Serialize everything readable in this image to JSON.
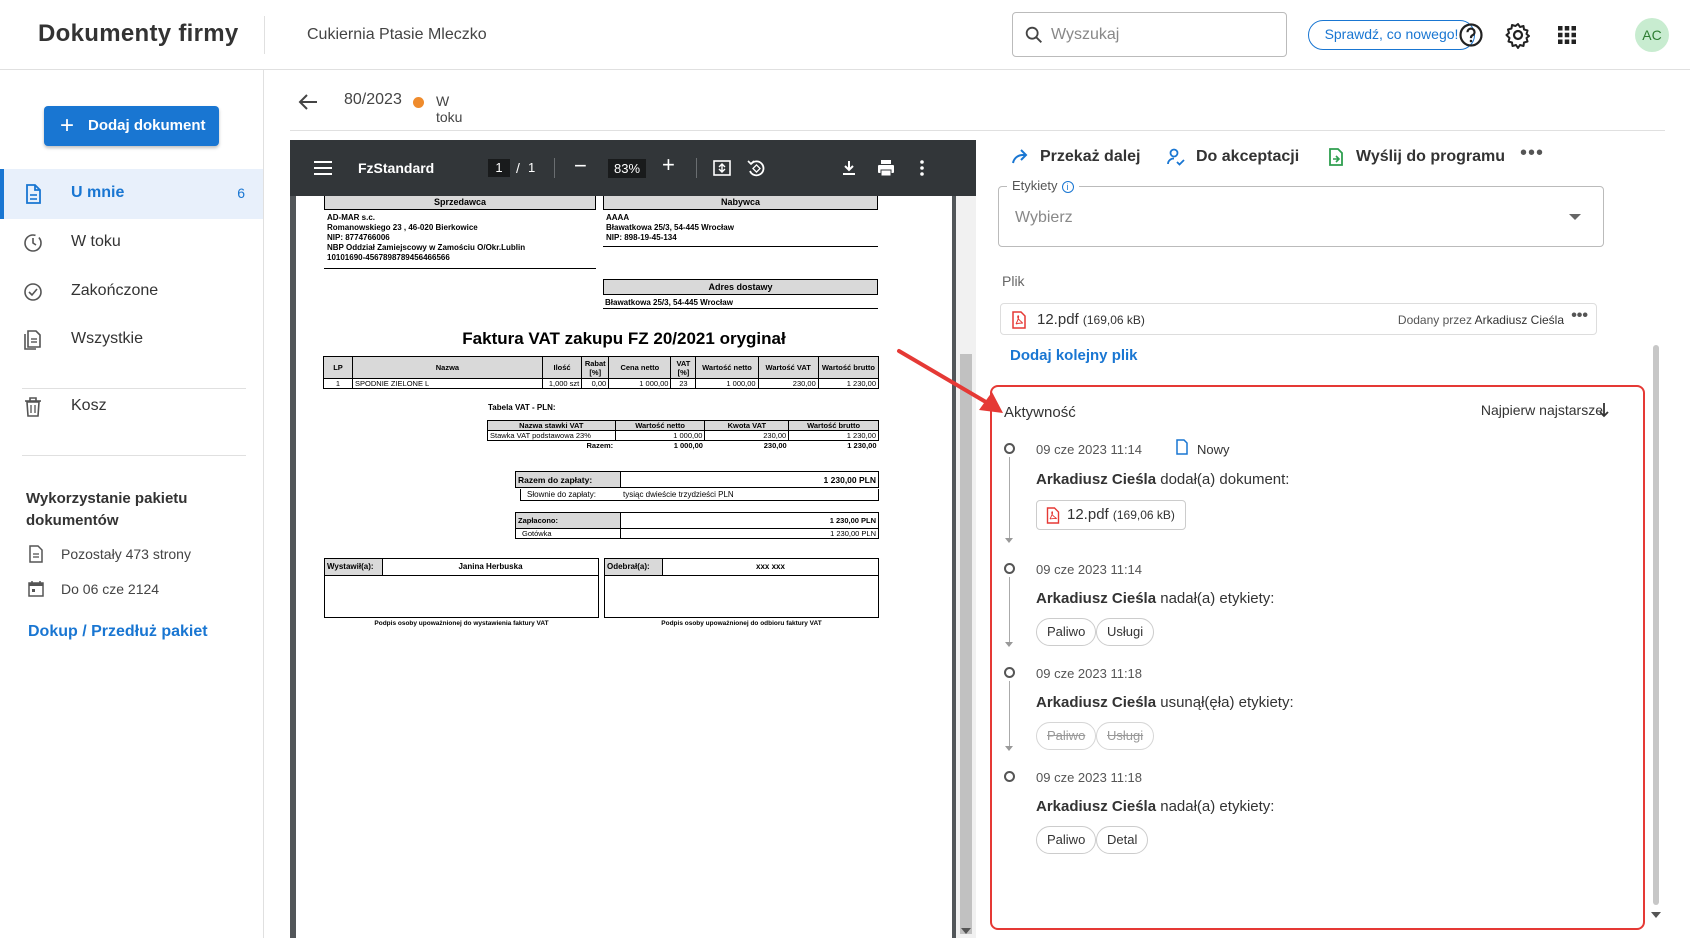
{
  "header": {
    "app_title": "Dokumenty firmy",
    "company": "Cukiernia Ptasie Mleczko",
    "search_placeholder": "Wyszukaj",
    "news_button": "Sprawdź, co nowego!",
    "avatar_initials": "AC",
    "icons": [
      "help-icon",
      "settings-icon",
      "apps-grid-icon"
    ]
  },
  "sidebar": {
    "add_button": "Dodaj dokument",
    "items": [
      {
        "label": "U mnie",
        "count": "6",
        "icon": "document-icon",
        "active": true
      },
      {
        "label": "W toku",
        "count": "",
        "icon": "clock-icon"
      },
      {
        "label": "Zakończone",
        "count": "",
        "icon": "check-circle-icon"
      },
      {
        "label": "Wszystkie",
        "count": "",
        "icon": "documents-icon"
      },
      {
        "label": "Kosz",
        "count": "",
        "icon": "trash-icon"
      }
    ],
    "package": {
      "title": "Wykorzystanie pakietu dokumentów",
      "remaining": "Pozostały 473 strony",
      "valid_until": "Do 06 cze 2124",
      "renew_link": "Dokup / Przedłuż pakiet"
    }
  },
  "breadcrumb": {
    "number": "80/2023",
    "status": "W toku",
    "status_color": "#ef8b2c"
  },
  "viewer": {
    "filename": "FzStandard",
    "page_current": "1",
    "page_sep": "/",
    "page_total": "1",
    "zoom": "83%",
    "zoom_minus": "−",
    "zoom_plus": "+"
  },
  "invoice": {
    "seller_header": "Sprzedawca",
    "seller_lines": [
      "AD-MAR s.c.",
      "Romanowskiego 23 , 46-020 Bierkowice",
      "NIP: 8774766006",
      "NBP Oddział Zamiejscowy w Zamościu  O/Okr.Lublin",
      "10101690-4567898789456466566"
    ],
    "buyer_header": "Nabywca",
    "buyer_lines": [
      "AAAA",
      "Bławatkowa 25/3, 54-445 Wrocław",
      "NIP: 898-19-45-134"
    ],
    "delivery_header": "Adres dostawy",
    "delivery_line": "Bławatkowa 25/3, 54-445 Wrocław",
    "title": "Faktura VAT zakupu FZ 20/2021 oryginał",
    "items_headers": [
      "LP",
      "Nazwa",
      "Ilość",
      "Rabat [%]",
      "Cena netto",
      "VAT [%]",
      "Wartość netto",
      "Wartość VAT",
      "Wartość brutto"
    ],
    "items_rows": [
      [
        "1",
        "SPODNIE ZIELONE L",
        "1,000 szt",
        "0,00",
        "1 000,00",
        "23",
        "1 000,00",
        "230,00",
        "1 230,00"
      ]
    ],
    "vat_table_label": "Tabela VAT - PLN:",
    "vat_headers": [
      "Nazwa stawki VAT",
      "Wartość netto",
      "Kwota VAT",
      "Wartość brutto"
    ],
    "vat_rows": [
      [
        "Stawka VAT podstawowa 23%",
        "1 000,00",
        "230,00",
        "1 230,00"
      ]
    ],
    "vat_sum": {
      "label": "Razem:",
      "net": "1 000,00",
      "vat": "230,00",
      "gross": "1 230,00"
    },
    "to_pay_label": "Razem do zapłaty:",
    "to_pay_value": "1 230,00 PLN",
    "in_words_label": "Słownie do zapłaty:",
    "in_words_value": "tysiąc dwieście trzydzieści PLN",
    "paid_label": "Zapłacono:",
    "paid_value": "1 230,00 PLN",
    "paid_method": "Gotówka",
    "paid_method_value": "1 230,00 PLN",
    "issuer_label": "Wystawił(a):",
    "issuer_name": "Janina Herbuska",
    "receiver_label": "Odebrał(a):",
    "receiver_name": "xxx xxx",
    "issuer_sig": "Podpis osoby upoważnionej do wystawienia faktury VAT",
    "receiver_sig": "Podpis osoby upoważnionej do odbioru faktury VAT"
  },
  "right_panel": {
    "actions": [
      "Przekaż dalej",
      "Do akceptacji",
      "Wyślij do programu"
    ],
    "more": "•••",
    "labels_legend": "Etykiety",
    "labels_placeholder": "Wybierz",
    "file_section": "Plik",
    "file": {
      "name": "12.pdf",
      "size": "(169,06 kB)",
      "added_prefix": "Dodany przez",
      "added_by": "Arkadiusz Cieśla",
      "more": "•••"
    },
    "add_file_link": "Dodaj kolejny plik"
  },
  "activity": {
    "title": "Aktywność",
    "sort": "Najpierw najstarsze",
    "entries": [
      {
        "time": "09 cze 2023 11:14",
        "badge": "Nowy",
        "user": "Arkadiusz Cieśla",
        "action": "dodał(a) dokument:",
        "file": "12.pdf",
        "file_size": "(169,06 kB)"
      },
      {
        "time": "09 cze 2023 11:14",
        "user": "Arkadiusz Cieśla",
        "action": "nadał(a) etykiety:",
        "tags": [
          "Paliwo",
          "Usługi"
        ]
      },
      {
        "time": "09 cze 2023 11:18",
        "user": "Arkadiusz Cieśla",
        "action": "usunął(ęła) etykiety:",
        "tags": [
          "Paliwo",
          "Usługi"
        ]
      },
      {
        "time": "09 cze 2023 11:18",
        "user": "Arkadiusz Cieśla",
        "action": "nadał(a) etykiety:",
        "tags": [
          "Paliwo",
          "Detal"
        ]
      }
    ]
  },
  "colors": {
    "accent": "#1976d2",
    "highlight": "#e53935",
    "pdf_red": "#e53935"
  }
}
